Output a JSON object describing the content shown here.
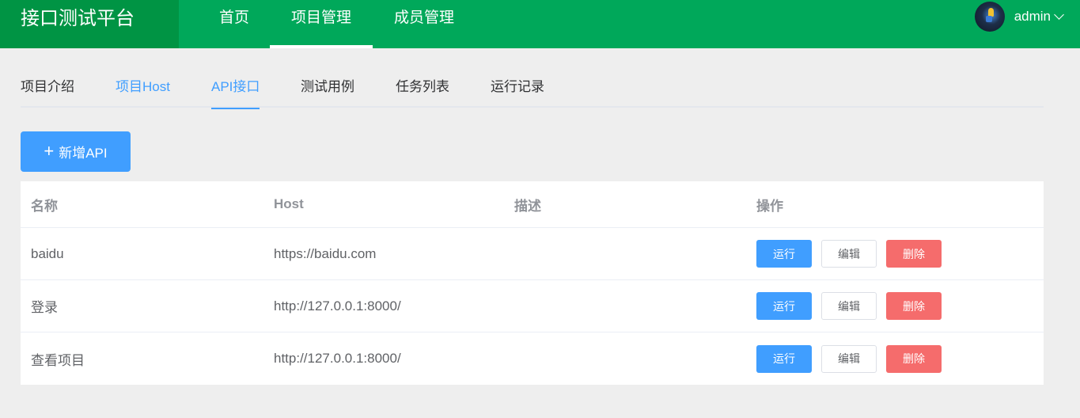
{
  "header": {
    "logo": "接口测试平台",
    "nav": [
      "首页",
      "项目管理",
      "成员管理"
    ],
    "user": "admin"
  },
  "tabs": [
    "项目介绍",
    "项目Host",
    "API接口",
    "测试用例",
    "任务列表",
    "运行记录"
  ],
  "add_button": {
    "icon": "+",
    "label": "新增API"
  },
  "table": {
    "columns": [
      "名称",
      "Host",
      "描述",
      "操作"
    ],
    "rows": [
      {
        "name": "baidu",
        "host": "https://baidu.com",
        "desc": ""
      },
      {
        "name": "登录",
        "host": "http://127.0.0.1:8000/",
        "desc": ""
      },
      {
        "name": "查看项目",
        "host": "http://127.0.0.1:8000/",
        "desc": ""
      }
    ],
    "actions": {
      "run": "运行",
      "edit": "编辑",
      "delete": "删除"
    }
  },
  "colors": {
    "header": "#00a85a",
    "logo_bg": "#009444",
    "primary": "#409eff",
    "danger": "#f56c6c"
  }
}
